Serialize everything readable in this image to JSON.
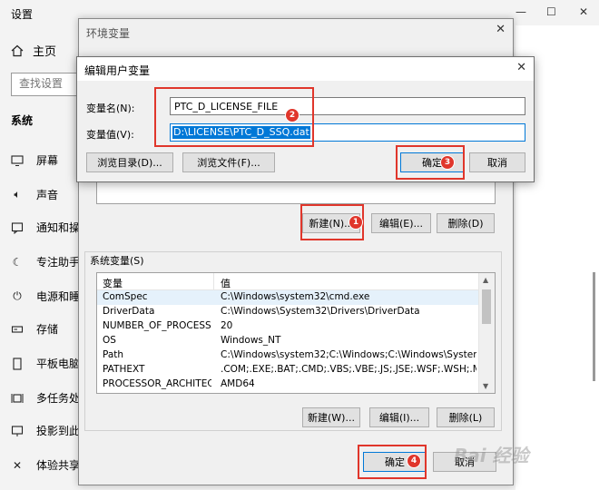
{
  "settings": {
    "title": "设置",
    "home": "主页",
    "search_placeholder": "查找设置",
    "section": "系统",
    "nav": [
      "屏幕",
      "声音",
      "通知和操",
      "专注助手",
      "电源和睡",
      "存储",
      "平板电脑",
      "多任务处",
      "投影到此",
      "体验共享"
    ]
  },
  "env_dialog": {
    "title": "环境变量",
    "user_buttons": {
      "new": "新建(N)...",
      "edit": "编辑(E)...",
      "delete": "删除(D)"
    },
    "system_group": "系统变量(S)",
    "columns": [
      "变量",
      "值"
    ],
    "system_vars": [
      {
        "name": "ComSpec",
        "value": "C:\\Windows\\system32\\cmd.exe"
      },
      {
        "name": "DriverData",
        "value": "C:\\Windows\\System32\\Drivers\\DriverData"
      },
      {
        "name": "NUMBER_OF_PROCESSORS",
        "value": "20"
      },
      {
        "name": "OS",
        "value": "Windows_NT"
      },
      {
        "name": "Path",
        "value": "C:\\Windows\\system32;C:\\Windows;C:\\Windows\\System32\\Wb..."
      },
      {
        "name": "PATHEXT",
        "value": ".COM;.EXE;.BAT;.CMD;.VBS;.VBE;.JS;.JSE;.WSF;.WSH;.MSC"
      },
      {
        "name": "PROCESSOR_ARCHITECT...",
        "value": "AMD64"
      }
    ],
    "system_buttons": {
      "new": "新建(W)...",
      "edit": "编辑(I)...",
      "delete": "删除(L)"
    },
    "ok": "确定",
    "cancel": "取消"
  },
  "edit_dialog": {
    "title": "编辑用户变量",
    "name_label": "变量名(N):",
    "name_value": "PTC_D_LICENSE_FILE",
    "value_label": "变量值(V):",
    "value_value": "D:\\LICENSE\\PTC_D_SSQ.dat",
    "browse_dir": "浏览目录(D)...",
    "browse_file": "浏览文件(F)...",
    "ok": "确定",
    "cancel": "取消"
  },
  "annotations": {
    "badges": [
      "1",
      "2",
      "3",
      "4"
    ],
    "color": "#e0362b"
  },
  "watermark": "Bai 经验"
}
